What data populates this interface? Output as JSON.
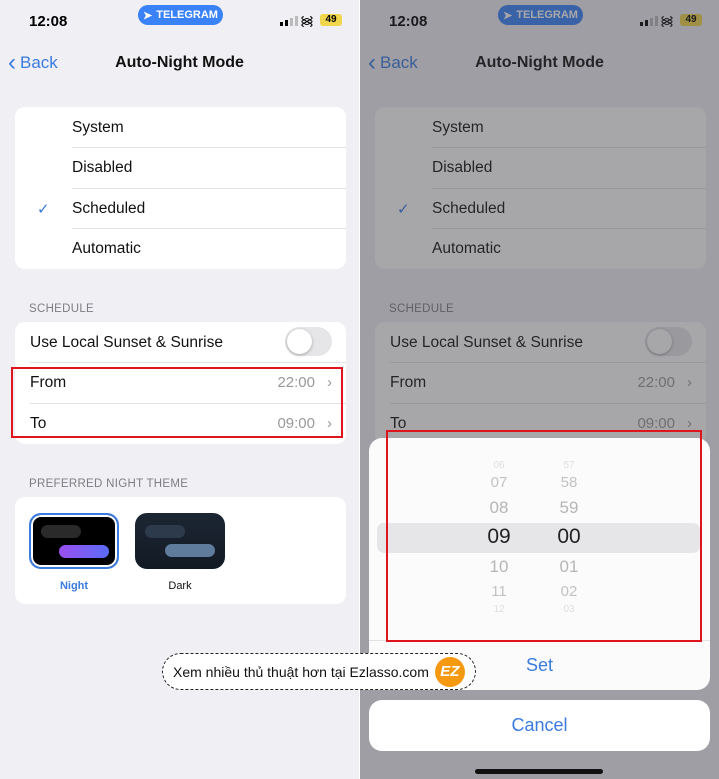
{
  "status": {
    "time": "12:08",
    "app_pill": "TELEGRAM",
    "battery": "49"
  },
  "nav": {
    "back": "Back",
    "title": "Auto-Night Mode"
  },
  "modes": [
    {
      "label": "System"
    },
    {
      "label": "Disabled"
    },
    {
      "label": "Scheduled",
      "checked": true
    },
    {
      "label": "Automatic"
    }
  ],
  "schedule": {
    "header": "SCHEDULE",
    "sunset_label": "Use Local Sunset & Sunrise",
    "sunset_on": false,
    "from_label": "From",
    "from_value": "22:00",
    "to_label": "To",
    "to_value": "09:00"
  },
  "theme": {
    "header": "PREFERRED NIGHT THEME",
    "items": [
      {
        "label": "Night",
        "selected": true
      },
      {
        "label": "Dark"
      }
    ]
  },
  "picker": {
    "hours": [
      "06",
      "07",
      "08",
      "09",
      "10",
      "11",
      "12"
    ],
    "minutes": [
      "57",
      "58",
      "59",
      "00",
      "01",
      "02",
      "03"
    ],
    "selected_hour": "09",
    "selected_minute": "00",
    "set": "Set",
    "cancel": "Cancel"
  },
  "watermark": {
    "text": "Xem nhiều thủ thuật hơn tại Ezlasso.com",
    "logo": "EZ"
  },
  "colors": {
    "accent": "#3a7be0",
    "highlight": "#e0141c"
  }
}
